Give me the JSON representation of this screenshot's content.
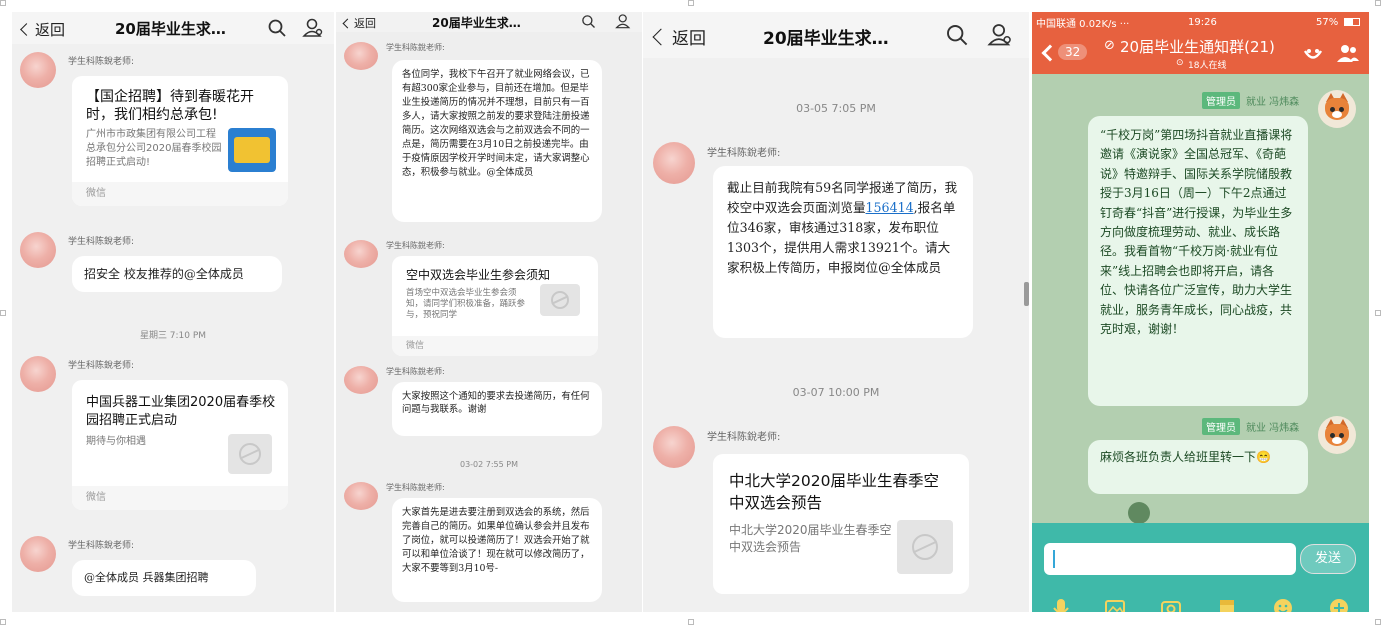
{
  "panel1": {
    "back_label": "返回",
    "title": "20届毕业生求…",
    "sender": "学生科陈銳老师:",
    "card1": {
      "title": "【国企招聘】待到春暖花开时，我们相约总承包!",
      "subtitle": "广州市市政集团有限公司工程总承包分公司2020届春季校园招聘正式启动!",
      "source": "微信"
    },
    "msg2": "招安全 校友推荐的@全体成员",
    "time1": "星期三 7:10 PM",
    "card2": {
      "title": "中国兵器工业集团2020届春季校园招聘正式启动",
      "subtitle": "期待与你相遇",
      "source": "微信"
    },
    "msg4": "@全体成员 兵器集团招聘"
  },
  "panel2": {
    "back_label": "返回",
    "title": "20届毕业生求…",
    "sender": "学生科陈銳老师:",
    "msg1": "各位同学，我校下午召开了就业网络会议，已有超300家企业参与，目前还在增加。但是毕业生投递简历的情况并不理想，目前只有一百多人，请大家按照之前发的要求登陆注册投递简历。这次网络双选会与之前双选会不同的一点是，简历需要在3月10日之前投递完毕。由于疫情原因学校开学时间未定，请大家调整心态，积极参与就业。@全体成员",
    "card": {
      "title": "空中双选会毕业生参会须知",
      "subtitle": "首场空中双选会毕业生参会须知，请同学们积极准备，踊跃参与，预祝同学",
      "source": "微信"
    },
    "msg3": "大家按照这个通知的要求去投递简历，有任何问题与我联系。谢谢",
    "time": "03-02 7:55 PM",
    "msg4": "大家首先是进去要注册到双选会的系统，然后完善自己的简历。如果单位确认参会并且发布了岗位，就可以投递简历了！双选会开始了就可以和单位洽谈了！现在就可以修改简历了，大家不要等到3月10号-"
  },
  "panel3": {
    "back_label": "返回",
    "title": "20届毕业生求…",
    "time1": "03-05 7:05 PM",
    "sender": "学生科陈銳老师:",
    "msg_before_link": "截止目前我院有59名同学报递了简历，我校空中双选会页面浏览量",
    "msg_link": "156414",
    "msg_after_link": ",报名单位346家，审核通过318家，发布职位1303个，提供用人需求13921个。请大家积极上传简历，申报岗位@全体成员",
    "time2": "03-07 10:00 PM",
    "card": {
      "title": "中北大学2020届毕业生春季空中双选会预告",
      "subtitle": "中北大学2020届毕业生春季空中双选会预告"
    }
  },
  "panel4": {
    "status": {
      "left": "中国联通 0.02K/s ···",
      "time": "19:26",
      "right": "57%"
    },
    "unread_badge": "32",
    "title": "20届毕业生通知群(21)",
    "online": "18人在线",
    "role": "管理员",
    "admin_name": "就业 冯炜森",
    "msg1": "“千校万岗”第四场抖音就业直播课将邀请《演说家》全国总冠军、《奇葩说》特邀辩手、国际关系学院储殷教授于3月16日（周一）下午2点通过钉奇春“抖音”进行授课，为毕业生多方向做度梳理劳动、就业、成长路径。我看首物“千校万岗·就业有位来”线上招聘会也即将开启，请各位、快请各位广泛宣传，助力大学生就业，服务青年成长，同心战疫，共克时艰，谢谢！",
    "msg2": "麻烦各班负责人给班里转一下😁",
    "send_label": "发送",
    "colors": {
      "header": "#e7613f",
      "input_bar": "#3fb9a9",
      "bubble": "#e8f6ea",
      "chat_bg": "#b3cfb0"
    }
  }
}
